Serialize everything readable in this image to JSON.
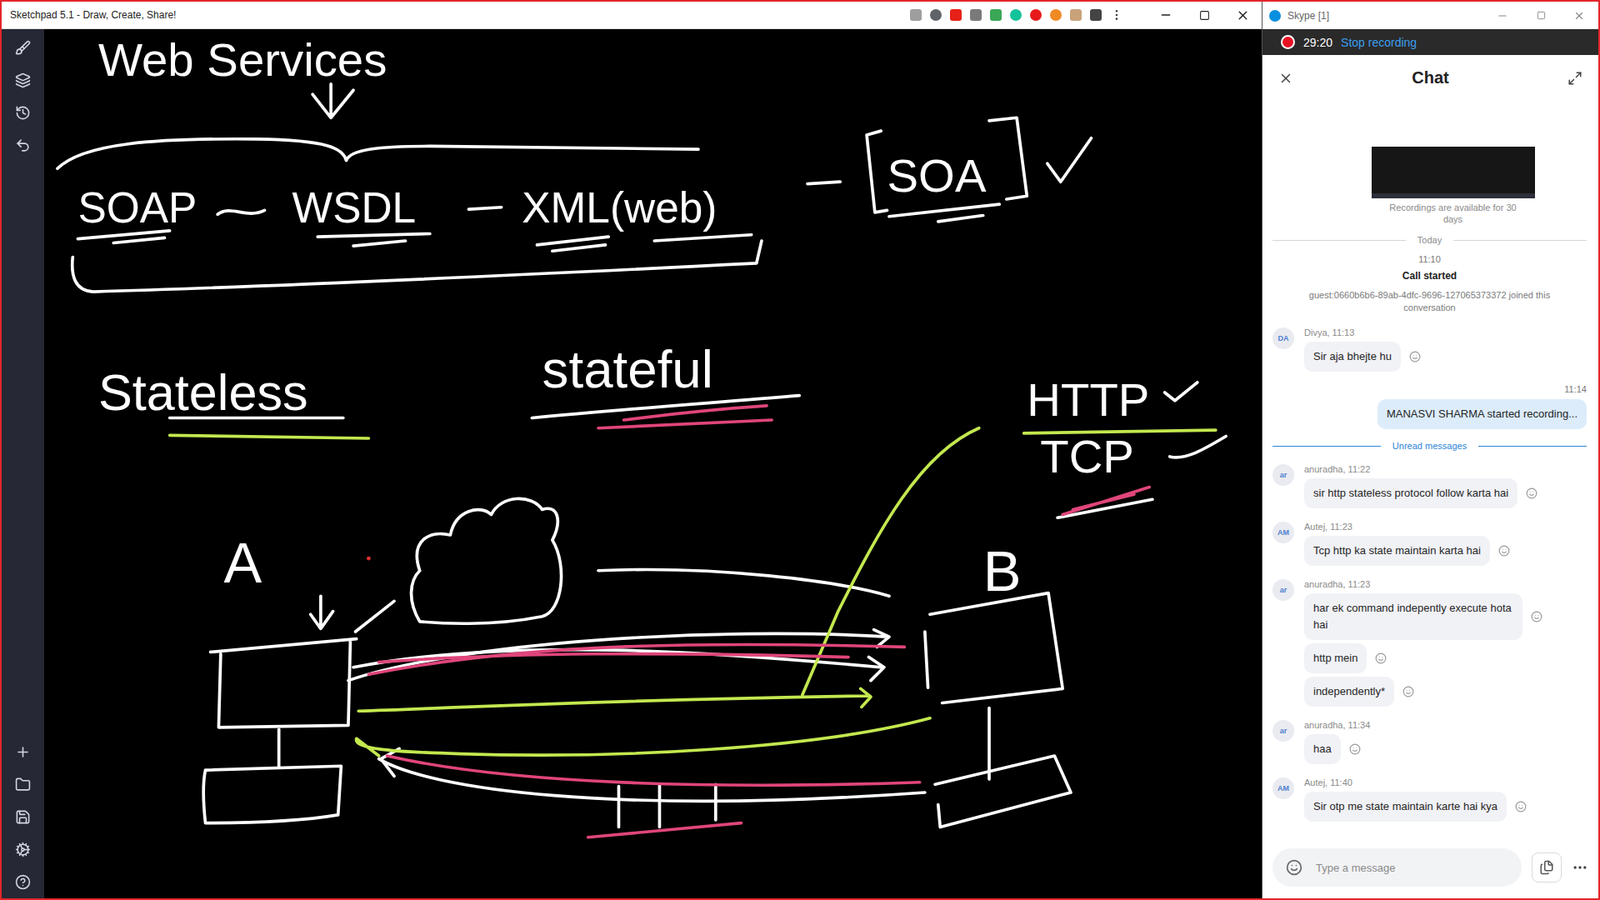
{
  "sketchpad": {
    "title": "Sketchpad 5.1 - Draw, Create, Share!",
    "canvas": {
      "heading": "Web Services",
      "terms": [
        "SOAP",
        "WSDL",
        "XML(web)"
      ],
      "architecture": "SOA",
      "states": [
        "Stateless",
        "stateful"
      ],
      "protocols": [
        "HTTP",
        "TCP"
      ],
      "nodes": [
        "A",
        "B"
      ]
    }
  },
  "skype": {
    "title": "Skype [1]",
    "recording": {
      "active": true,
      "timer": "29:20",
      "action": "Stop recording"
    },
    "chat": {
      "title": "Chat",
      "feed": [
        {
          "kind": "preview",
          "note": "Recordings are available for 30 days"
        },
        {
          "kind": "day",
          "text": "Today"
        },
        {
          "kind": "system",
          "time": "11:10",
          "title": "Call started",
          "text": "guest:0660b6b6-89ab-4dfc-9696-127065373372 joined this conversation"
        },
        {
          "kind": "incoming",
          "initials": "DA",
          "sender": "Divya, 11:13",
          "bubbles": [
            "Sir aja bhejte hu"
          ]
        },
        {
          "kind": "outgoing",
          "time": "11:14",
          "bubbles": [
            "MANASVI SHARMA started recording..."
          ]
        },
        {
          "kind": "divider",
          "text": "Unread messages"
        },
        {
          "kind": "incoming",
          "initials": "ar",
          "sender": "anuradha, 11:22",
          "bubbles": [
            "sir http stateless protocol follow karta hai"
          ]
        },
        {
          "kind": "incoming",
          "initials": "AM",
          "sender": "Autej, 11:23",
          "bubbles": [
            "Tcp http ka state maintain karta hai"
          ]
        },
        {
          "kind": "incoming",
          "initials": "ar",
          "sender": "anuradha, 11:23",
          "bubbles": [
            "har ek command indepently execute hota hai",
            "http mein",
            "independently*"
          ]
        },
        {
          "kind": "incoming",
          "initials": "ar",
          "sender": "anuradha, 11:34",
          "bubbles": [
            "haa"
          ]
        },
        {
          "kind": "incoming",
          "initials": "AM",
          "sender": "Autej, 11:40",
          "bubbles": [
            "Sir otp me state maintain karte hai kya"
          ]
        }
      ],
      "composer": {
        "placeholder": "Type a message"
      }
    }
  }
}
